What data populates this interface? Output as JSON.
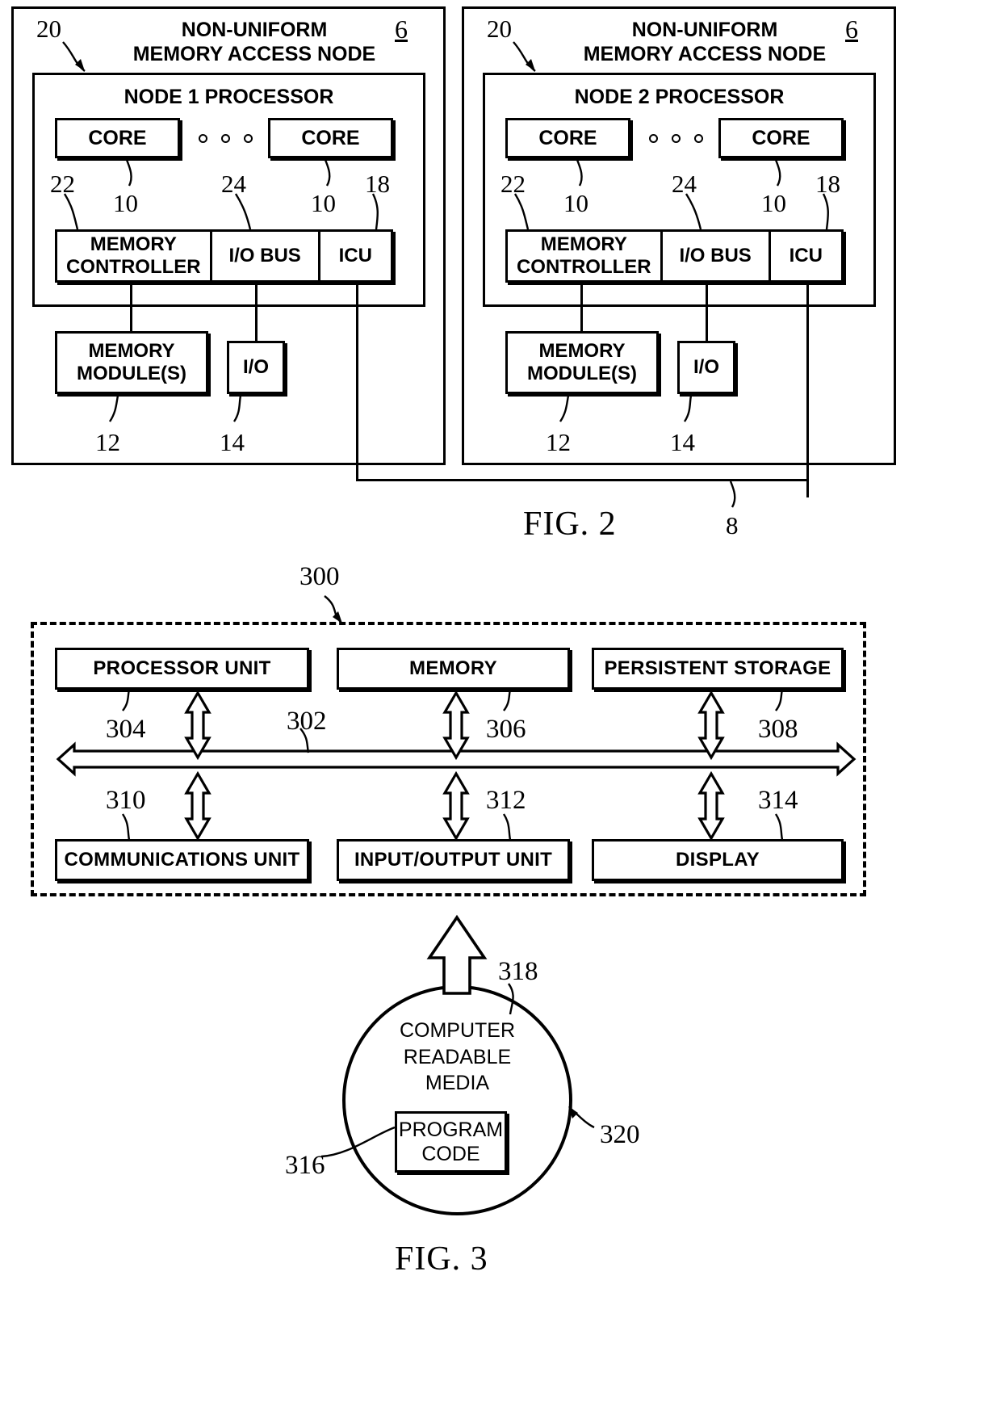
{
  "figures": [
    {
      "caption": "FIG. 2",
      "interconnect_ref": "8",
      "nodes": [
        {
          "title": "NON-UNIFORM\nMEMORY ACCESS NODE",
          "node_ref": "6",
          "pointer_ref": "20",
          "processor_title": "NODE 1 PROCESSOR",
          "core_left": "CORE",
          "core_right": "CORE",
          "core_left_ref": "10",
          "core_right_ref": "10",
          "ellipsis_ref": "24",
          "memory_controller": "MEMORY\nCONTROLLER",
          "memory_controller_ref": "22",
          "io_bus": "I/O BUS",
          "icu": "ICU",
          "icu_ref": "18",
          "memory_modules": "MEMORY\nMODULE(S)",
          "memory_modules_ref": "12",
          "io": "I/O",
          "io_ref": "14"
        },
        {
          "title": "NON-UNIFORM\nMEMORY ACCESS NODE",
          "node_ref": "6",
          "pointer_ref": "20",
          "processor_title": "NODE 2 PROCESSOR",
          "core_left": "CORE",
          "core_right": "CORE",
          "core_left_ref": "10",
          "core_right_ref": "10",
          "ellipsis_ref": "24",
          "memory_controller": "MEMORY\nCONTROLLER",
          "memory_controller_ref": "22",
          "io_bus": "I/O BUS",
          "icu": "ICU",
          "icu_ref": "18",
          "memory_modules": "MEMORY\nMODULE(S)",
          "memory_modules_ref": "12",
          "io": "I/O",
          "io_ref": "14"
        }
      ]
    },
    {
      "caption": "FIG. 3",
      "system_ref": "300",
      "bus_ref": "302",
      "top_units": [
        {
          "label": "PROCESSOR UNIT",
          "ref": "304"
        },
        {
          "label": "MEMORY",
          "ref": "306"
        },
        {
          "label": "PERSISTENT STORAGE",
          "ref": "308"
        }
      ],
      "bottom_units": [
        {
          "label": "COMMUNICATIONS UNIT",
          "ref": "310"
        },
        {
          "label": "INPUT/OUTPUT UNIT",
          "ref": "312"
        },
        {
          "label": "DISPLAY",
          "ref": "314"
        }
      ],
      "media": {
        "label": "COMPUTER\nREADABLE\nMEDIA",
        "ref": "318",
        "program_code": "PROGRAM\nCODE",
        "program_code_ref": "316",
        "product_ref": "320"
      }
    }
  ]
}
